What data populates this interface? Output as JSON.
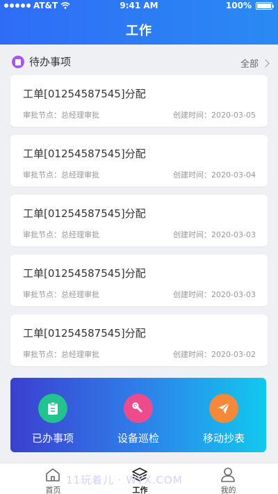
{
  "status_bar": {
    "carrier": "AT&T",
    "time": "9:41 AM",
    "battery": "100%"
  },
  "header": {
    "title": "工作"
  },
  "todo": {
    "title": "待办事项",
    "more_label": "全部",
    "items": [
      {
        "title": "工单[01254587545]分配",
        "node": "审批节点：总经理审批",
        "time": "创建时间：2020-03-05"
      },
      {
        "title": "工单[01254587545]分配",
        "node": "审批节点：总经理审批",
        "time": "创建时间：2020-03-04"
      },
      {
        "title": "工单[01254587545]分配",
        "node": "审批节点：总经理审批",
        "time": "创建时间：2020-03-03"
      },
      {
        "title": "工单[01254587545]分配",
        "node": "审批节点：总经理审批",
        "time": "创建时间：2020-03-03"
      },
      {
        "title": "工单[01254587545]分配",
        "node": "审批节点：总经理审批",
        "time": "创建时间：2020-03-02"
      }
    ]
  },
  "quick_actions": [
    {
      "label": "已办事项",
      "icon": "clipboard-icon",
      "color": "#22c38e"
    },
    {
      "label": "设备巡检",
      "icon": "wrench-icon",
      "color": "#ec4c8c"
    },
    {
      "label": "移动抄表",
      "icon": "paper-plane-icon",
      "color": "#f5893a"
    }
  ],
  "tabbar": {
    "tabs": [
      {
        "label": "首页",
        "icon": "home-icon"
      },
      {
        "label": "工作",
        "icon": "layers-icon"
      },
      {
        "label": "我的",
        "icon": "user-icon"
      }
    ]
  },
  "watermark": "11玩着儿 · WYX.COM",
  "colors": {
    "header_gradient_start": "#2f6cf6",
    "header_gradient_end": "#2a8af3",
    "panel_gradient_start": "#3b3fcf",
    "panel_gradient_end": "#11c9ef"
  }
}
